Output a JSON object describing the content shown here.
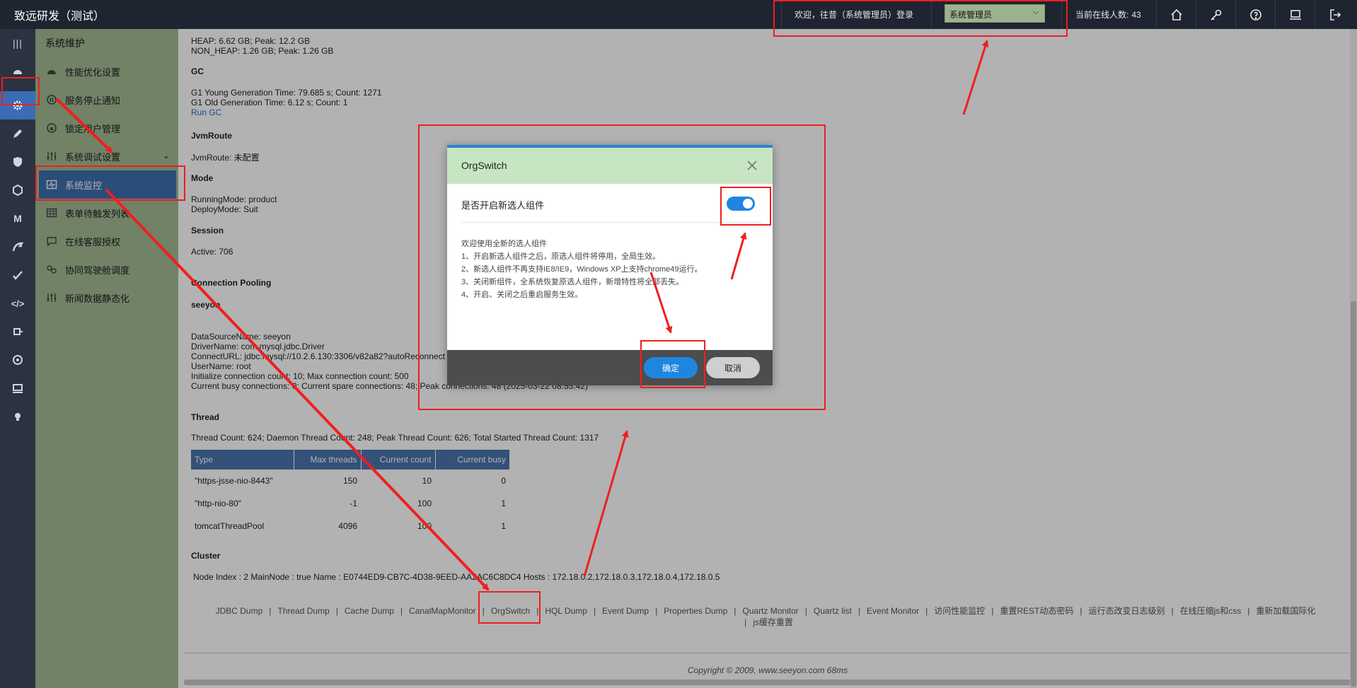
{
  "topbar": {
    "app_title": "致远研发（测试）",
    "welcome": "欢迎，往昔（系统管理员）登录",
    "role_value": "系统管理员",
    "online_label": "当前在线人数:",
    "online_count": "43"
  },
  "sidebar": {
    "title": "系统维护",
    "items": [
      {
        "label": "性能优化设置",
        "icon": "speedometer-icon"
      },
      {
        "label": "服务停止通知",
        "icon": "pause-circle-icon"
      },
      {
        "label": "锁定用户管理",
        "icon": "lock-user-icon"
      },
      {
        "label": "系统调试设置",
        "icon": "sliders-icon"
      },
      {
        "label": "系统监控",
        "icon": "monitor-pulse-icon"
      },
      {
        "label": "表单待触发列表",
        "icon": "grid-table-icon"
      },
      {
        "label": "在线客服授权",
        "icon": "chat-icon"
      },
      {
        "label": "协同驾驶舱调度",
        "icon": "link-icon"
      },
      {
        "label": "新闻数据静态化",
        "icon": "sliders-icon"
      }
    ]
  },
  "main": {
    "heap": "HEAP: 6.62 GB; Peak: 12.2 GB",
    "nonheap": "NON_HEAP: 1.26 GB; Peak: 1.26 GB",
    "gc_title": "GC",
    "gc_young": "G1 Young Generation  Time: 79.685 s; Count: 1271",
    "gc_old": "G1 Old Generation  Time: 6.12 s; Count: 1",
    "run_gc": "Run GC",
    "jvmroute_title": "JvmRoute",
    "jvmroute": "JvmRoute: 未配置",
    "mode_title": "Mode",
    "running_mode": "RunningMode: product",
    "deploy_mode": "DeployMode: Suit",
    "session_title": "Session",
    "session_active": "Active: 706",
    "pool_title": "Connection Pooling",
    "pool_name": "seeyon",
    "ds_name": "DataSourceName: seeyon",
    "driver": "DriverName: com.mysql.jdbc.Driver",
    "connect_url": "ConnectURL: jdbc:mysql://10.2.6.130:3306/v82a82?autoReconnect",
    "username": "UserName: root",
    "init_conn": "Initialize connection count: 10; Max connection count: 500",
    "current_conn": "Current busy connections: 0; Current spare connections: 48; Peak connections: 48 (2025-03-22 08:55:42)",
    "thread_title": "Thread",
    "thread_summary": "Thread Count: 624; Daemon Thread Count: 248; Peak Thread Count: 626; Total Started Thread Count: 1317",
    "thread_headers": [
      "Type",
      "Max threads",
      "Current count",
      "Current busy"
    ],
    "thread_rows": [
      [
        "\"https-jsse-nio-8443\"",
        "150",
        "10",
        "0"
      ],
      [
        "\"http-nio-80\"",
        "-1",
        "100",
        "1"
      ],
      [
        "tomcatThreadPool",
        "4096",
        "100",
        "1"
      ]
    ],
    "cluster_title": "Cluster",
    "cluster_info": "Node Index : 2 MainNode : true Name : E0744ED9-CB7C-4D38-9EED-AA2AC6C8DC4 Hosts : 172.18.0.2,172.18.0.3,172.18.0.4,172.18.0.5",
    "footer_links": [
      "JDBC Dump",
      "Thread Dump",
      "Cache Dump",
      "CanalMapMonitor",
      "OrgSwitch",
      "HQL Dump",
      "Event Dump",
      "Properties Dump",
      "Quartz Monitor",
      "Quartz list",
      "Event Monitor",
      "访问性能监控",
      "重置REST动态密码",
      "运行态改变日志级别",
      "在线压缩js和css",
      "重新加载国际化",
      "js缓存重置"
    ],
    "copyright": "Copyright © 2009, www.seeyon.com 68ms"
  },
  "modal": {
    "title": "OrgSwitch",
    "toggle_label": "是否开启新选人组件",
    "toggle_on": true,
    "desc_lines": [
      "欢迎使用全新的选人组件",
      "1、开启新选人组件之后，原选人组件将停用，全局生效。",
      "2、新选人组件不再支持IE8/IE9，Windows XP上支持chrome49运行。",
      "3、关闭新组件，全系统恢复原选人组件，新增特性将全部丢失。",
      "4、开启、关闭之后重启服务生效。"
    ],
    "ok_label": "确定",
    "cancel_label": "取消"
  },
  "colors": {
    "accent": "#1f86e0",
    "sidebar_bg": "#a3bb92",
    "sidebar_active": "#3e6fae",
    "topbar_bg": "#1e2430",
    "annotation": "#ef1f1f"
  }
}
